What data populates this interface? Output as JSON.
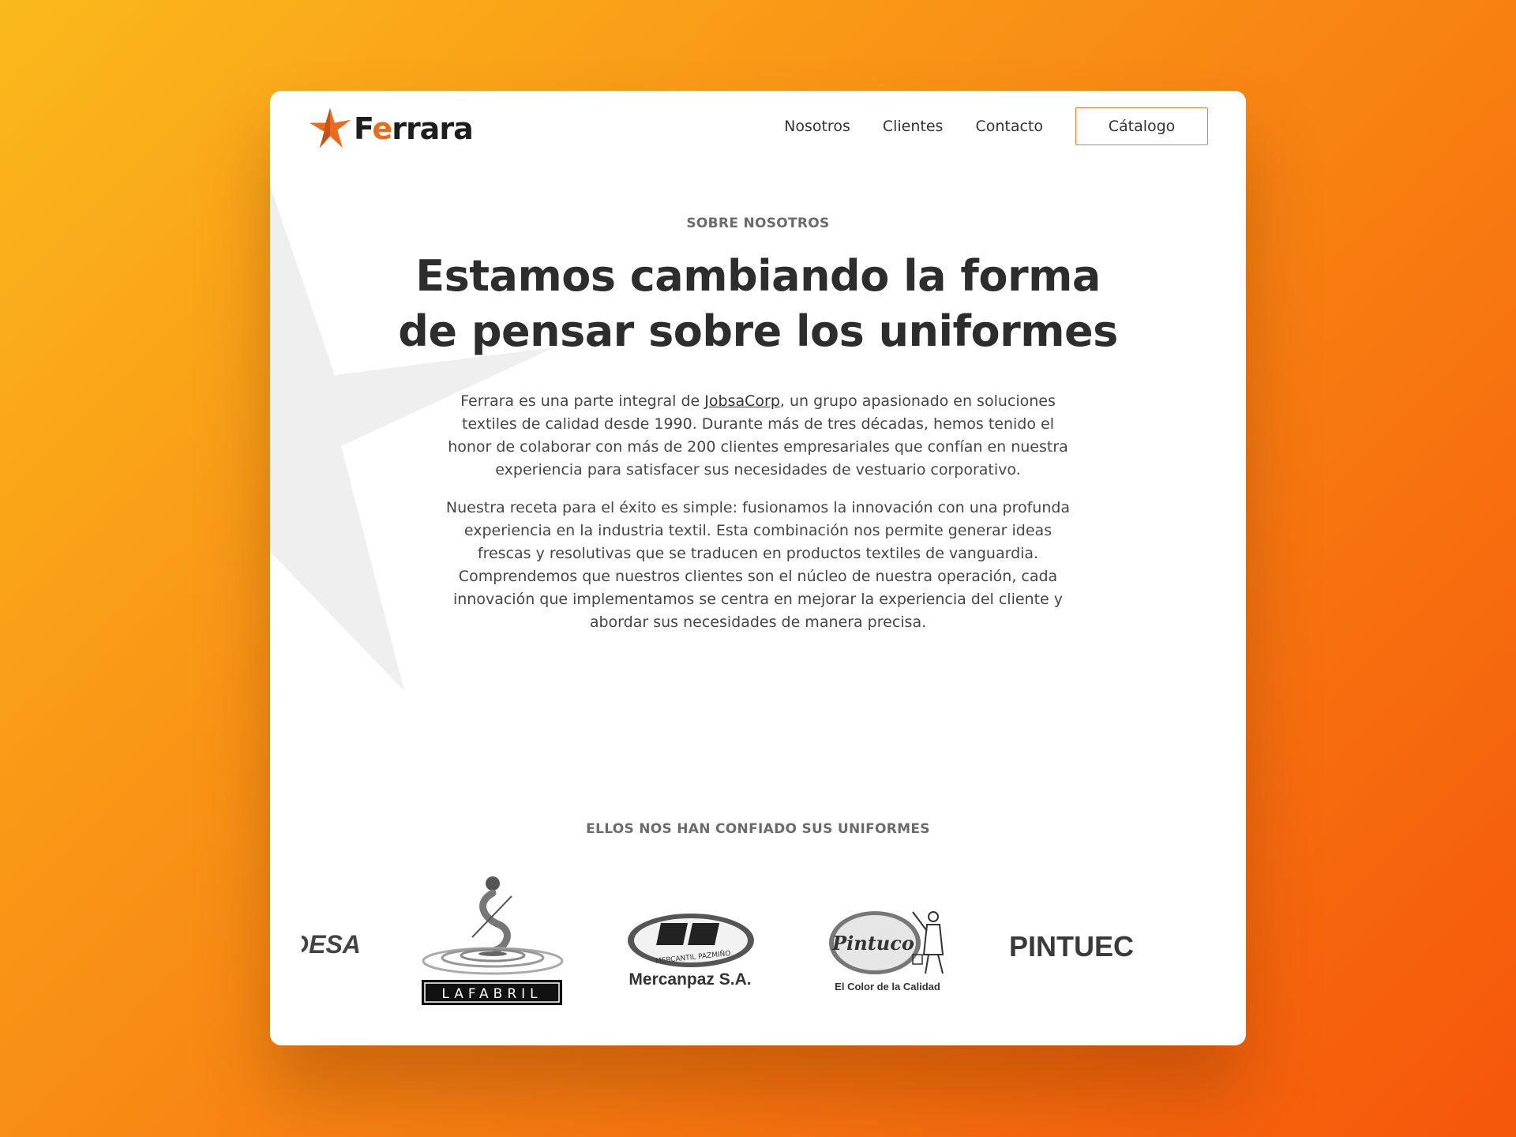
{
  "brand": {
    "name_first": "F",
    "name_accent": "e",
    "name_rest": "rrara",
    "accent_color": "#ea6b1e"
  },
  "nav": {
    "links": [
      "Nosotros",
      "Clientes",
      "Contacto"
    ],
    "cta_label": "Cátalogo"
  },
  "about": {
    "eyebrow": "SOBRE NOSOTROS",
    "headline_line1": "Estamos cambiando la forma",
    "headline_line2": "de pensar sobre los uniformes",
    "p1_before": "Ferrara es una parte integral de ",
    "p1_link": "JobsaCorp",
    "p1_after": ", un grupo apasionado en soluciones textiles de calidad desde 1990. Durante más de tres décadas, hemos tenido el honor de colaborar con más de 200 clientes empresariales que confían en nuestra experiencia para satisfacer sus necesidades de vestuario corporativo.",
    "p2": "Nuestra receta para el éxito es simple: fusionamos la innovación con una profunda experiencia en la industria textil. Esta combinación nos permite generar ideas frescas y resolutivas que se traducen en productos textiles de vanguardia. Comprendemos que nuestros clientes son el núcleo de nuestra operación, cada innovación que implementamos se centra en mejorar la experiencia del cliente y abordar sus necesidades de manera precisa."
  },
  "clients": {
    "title": "ELLOS NOS HAN CONFIADO SUS UNIFORMES",
    "logos": [
      {
        "name": "DESA",
        "text": "DESA"
      },
      {
        "name": "La Fabril",
        "text": "LAFABRIL"
      },
      {
        "name": "Mercanpaz",
        "text": "Mercanpaz S.A.",
        "subtext": "MERCANTIL PAZMIÑO"
      },
      {
        "name": "Pintuco",
        "text": "Pintuco",
        "subtext": "El Color de la Calidad"
      },
      {
        "name": "Pintuec",
        "text": "PINTUEC"
      }
    ]
  }
}
